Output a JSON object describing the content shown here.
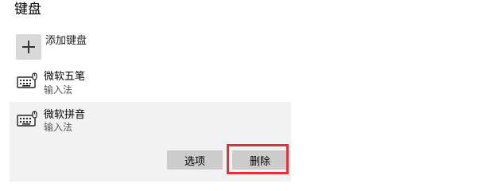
{
  "section": {
    "title": "键盘"
  },
  "add_keyboard": {
    "label": "添加键盘",
    "icon": "plus-icon"
  },
  "keyboards": [
    {
      "name": "微软五笔",
      "subtitle": "输入法",
      "icon": "keyboard-icon"
    },
    {
      "name": "微软拼音",
      "subtitle": "输入法",
      "icon": "keyboard-icon",
      "selected": true
    }
  ],
  "actions": {
    "options_label": "选项",
    "delete_label": "删除"
  },
  "colors": {
    "selected_bg": "#f2f2f2",
    "button_bg": "#cccccc",
    "highlight_border": "#e5303a"
  }
}
